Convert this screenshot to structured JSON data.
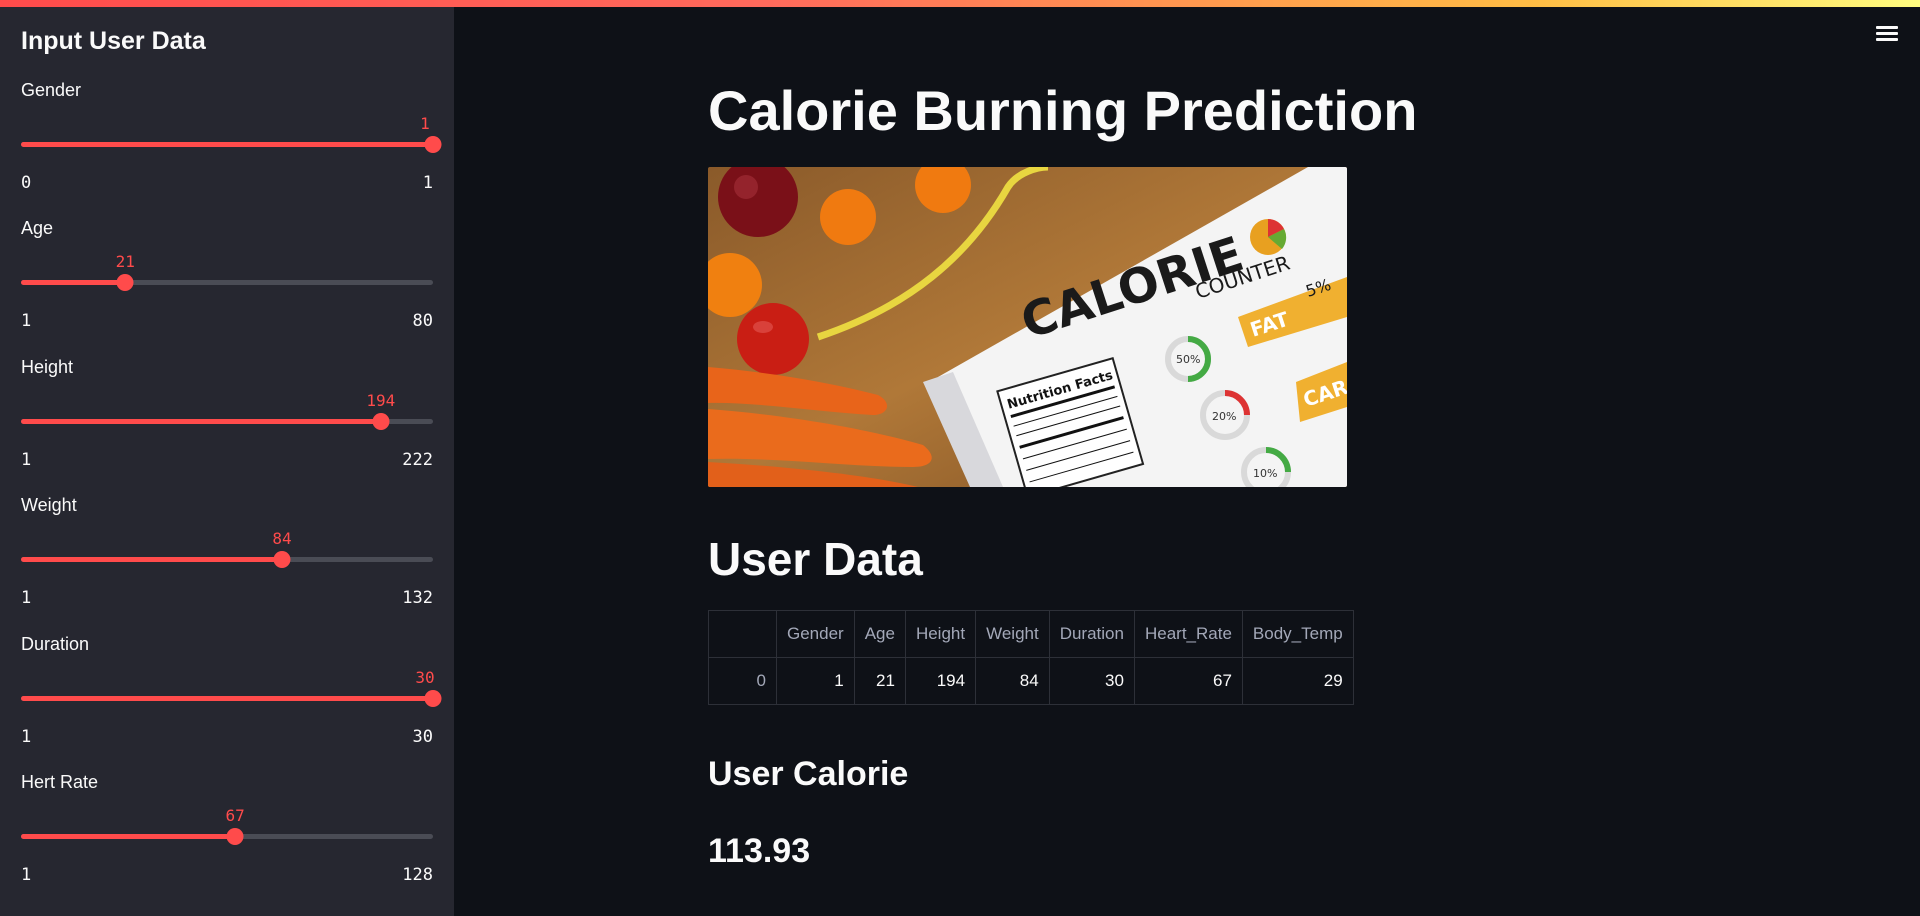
{
  "sidebar": {
    "title": "Input User Data",
    "sliders": [
      {
        "label": "Gender",
        "value": 1,
        "min": 0,
        "max": 1
      },
      {
        "label": "Age",
        "value": 21,
        "min": 1,
        "max": 80
      },
      {
        "label": "Height",
        "value": 194,
        "min": 1,
        "max": 222
      },
      {
        "label": "Weight",
        "value": 84,
        "min": 1,
        "max": 132
      },
      {
        "label": "Duration",
        "value": 30,
        "min": 1,
        "max": 30
      },
      {
        "label": "Hert Rate",
        "value": 67,
        "min": 1,
        "max": 128
      }
    ]
  },
  "main": {
    "title": "Calorie Burning Prediction",
    "image": {
      "title_text": "CALORIE",
      "subtitle_text": "COUNTER",
      "label_text": "Nutrition Facts",
      "pct_5": "5%",
      "fat_text": "FAT",
      "car_text": "CAR",
      "pct_50": "50%",
      "pct_20": "20%",
      "pct_10": "10%"
    },
    "user_data_heading": "User Data",
    "table": {
      "columns": [
        "",
        "Gender",
        "Age",
        "Height",
        "Weight",
        "Duration",
        "Heart_Rate",
        "Body_Temp"
      ],
      "rows": [
        [
          "0",
          "1",
          "21",
          "194",
          "84",
          "30",
          "67",
          "29"
        ]
      ]
    },
    "user_calorie_heading": "User Calorie",
    "calorie_value": "113.93"
  },
  "menu_icon": "hamburger-menu-icon",
  "colors": {
    "accent": "#ff4b4b",
    "background": "#0e1117",
    "sidebar": "#262730"
  }
}
